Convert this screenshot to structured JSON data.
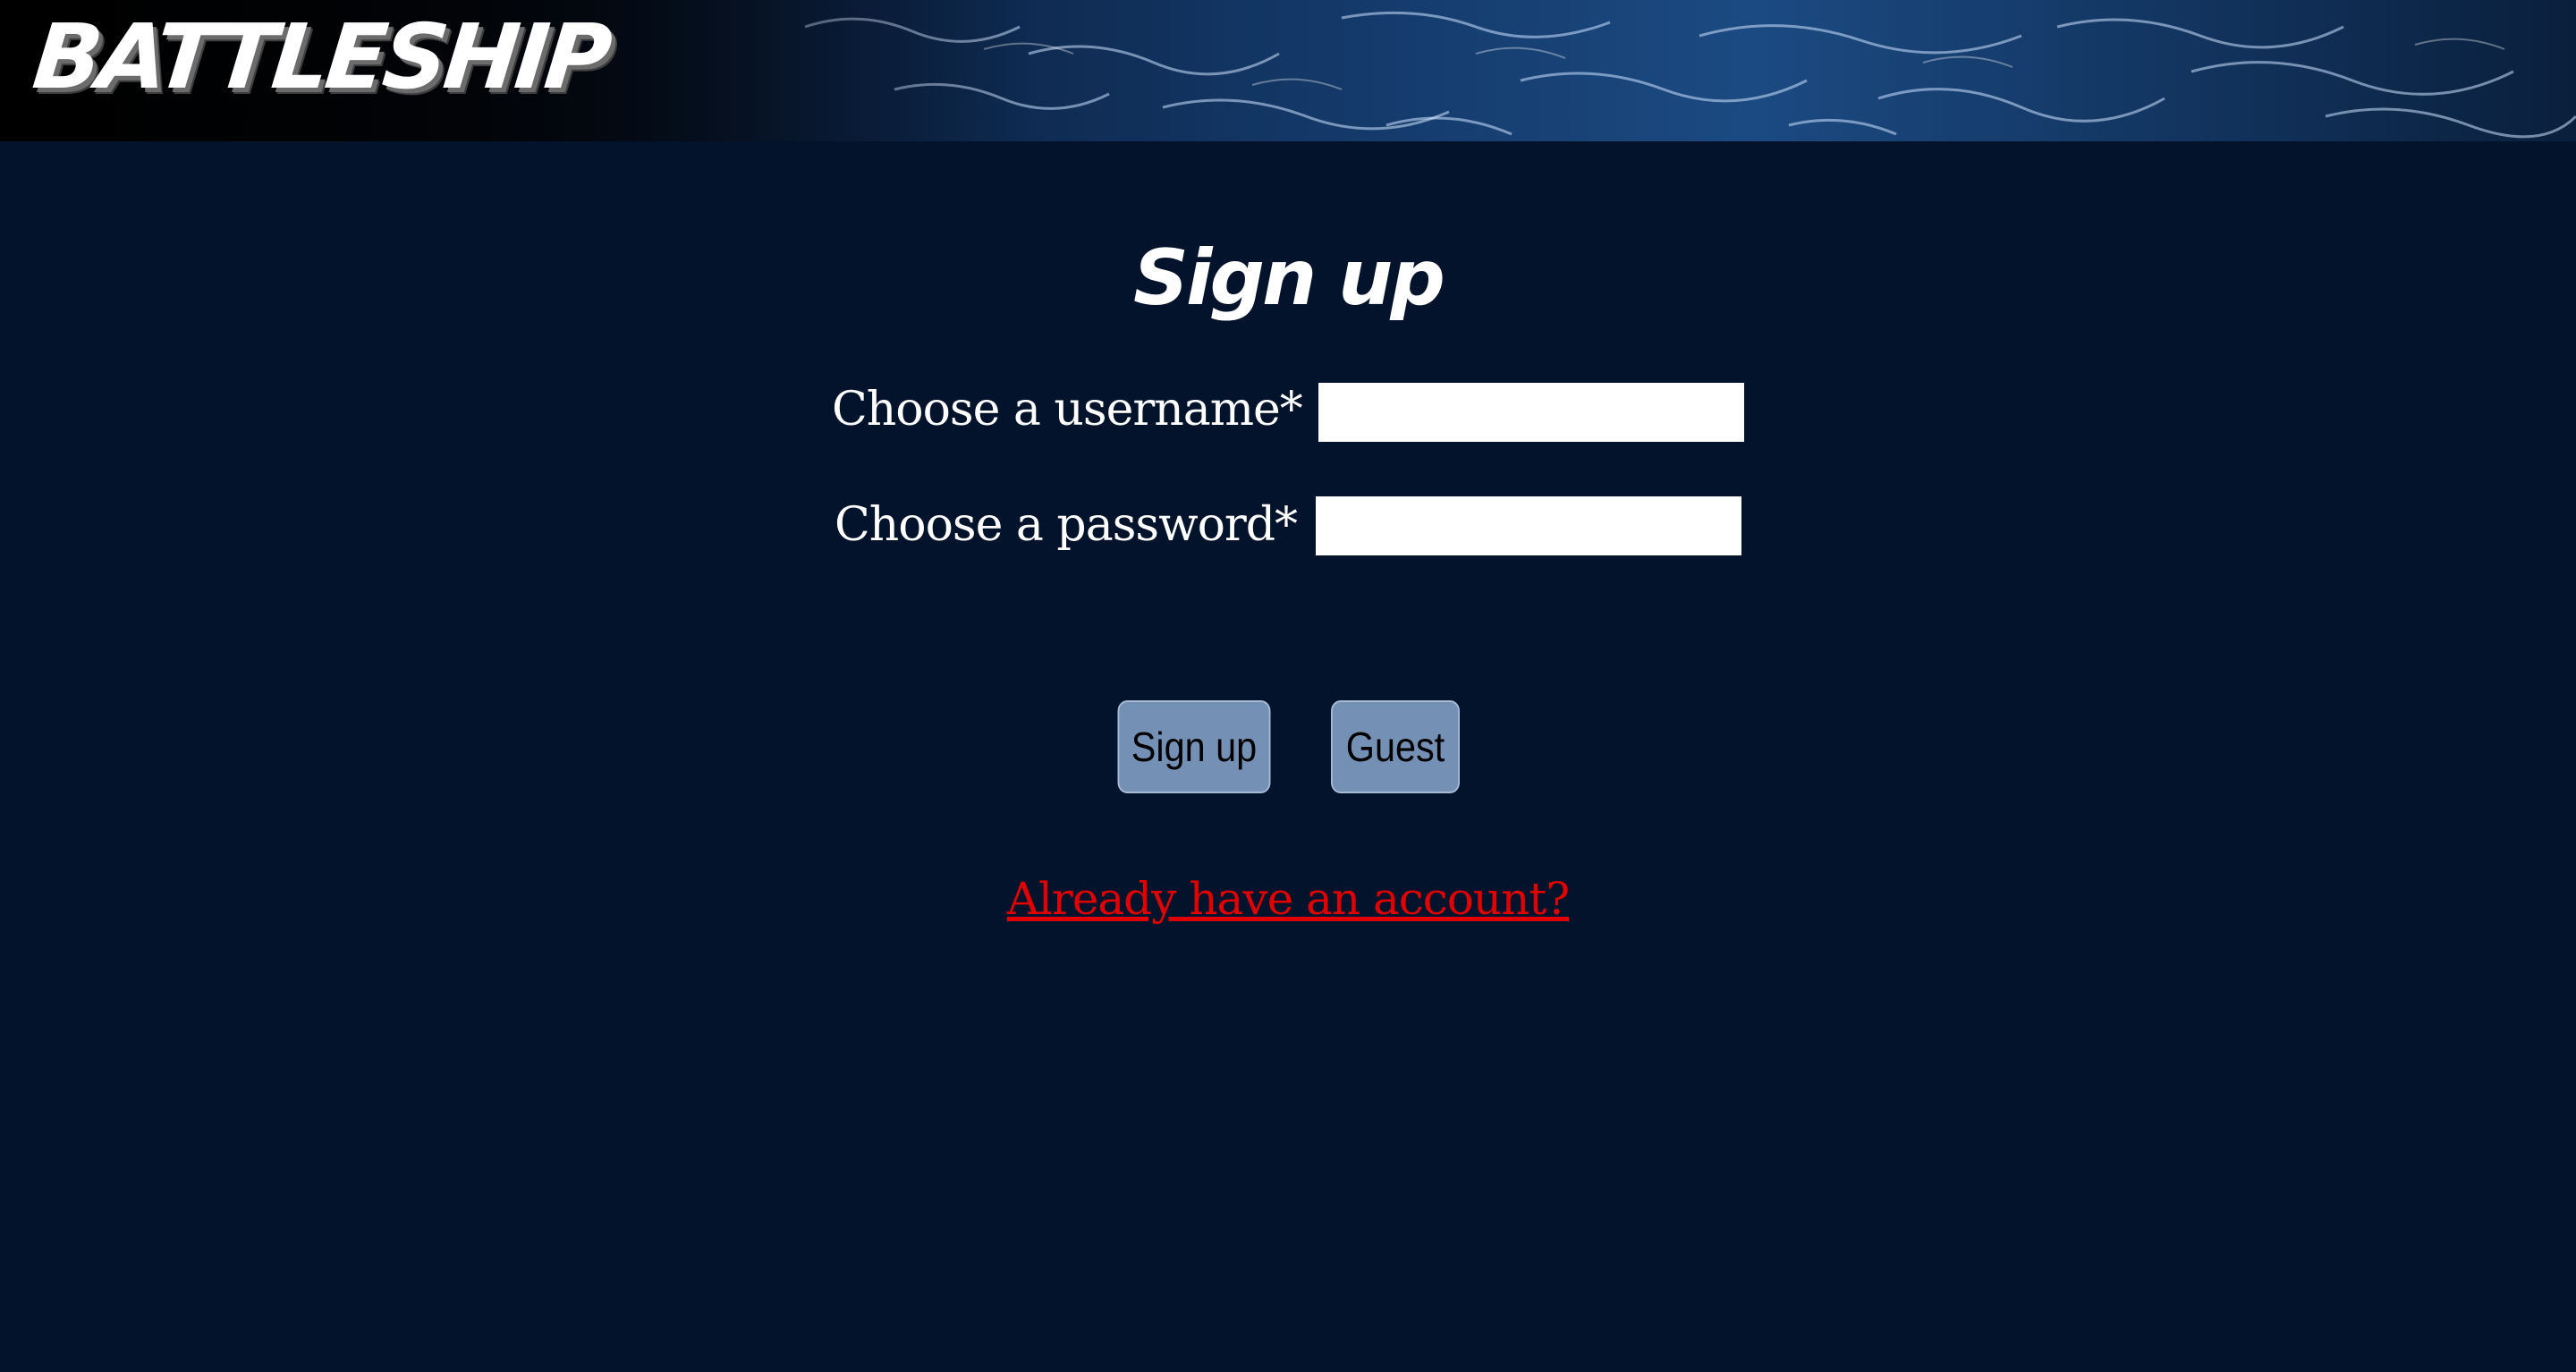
{
  "header": {
    "logo_text": "BATTLESHIP",
    "background": "ocean-water-image"
  },
  "signup_form": {
    "title": "Sign up",
    "username_label": "Choose a username*",
    "username_value": "",
    "password_label": "Choose a password*",
    "password_value": ""
  },
  "actions": {
    "signup_button": "Sign up",
    "guest_button": "Guest"
  },
  "login_link": "Already have an account?",
  "colors": {
    "page_background": "#03132b",
    "button_background": "#7590b5",
    "link_color": "#e00000"
  }
}
